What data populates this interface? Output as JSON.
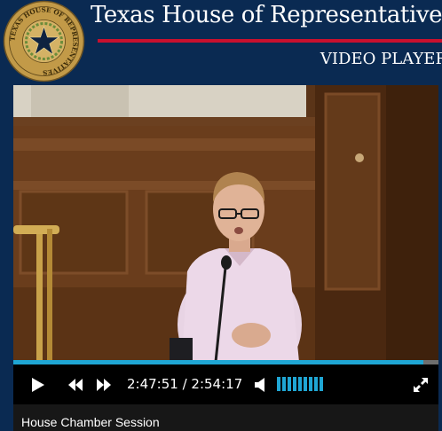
{
  "header": {
    "site_title": "Texas House of Representatives",
    "subtitle": "VIDEO PLAYER",
    "seal_text": "TEXAS HOUSE OF REPRESENTATIVES"
  },
  "player": {
    "current_time": "2:47:51",
    "duration": "2:54:17",
    "time_display": "2:47:51 / 2:54:17",
    "progress_fraction": 0.964,
    "volume_level_bars": 9,
    "caption": "House Chamber Session"
  },
  "colors": {
    "navy": "#0a2a52",
    "accent_red": "#c8102e",
    "progress_blue": "#1fa6d4",
    "seal_gold": "#b8903a"
  },
  "icons": [
    "seal-icon",
    "play-icon",
    "rewind-icon",
    "fast-forward-icon",
    "volume-icon",
    "fullscreen-icon"
  ]
}
